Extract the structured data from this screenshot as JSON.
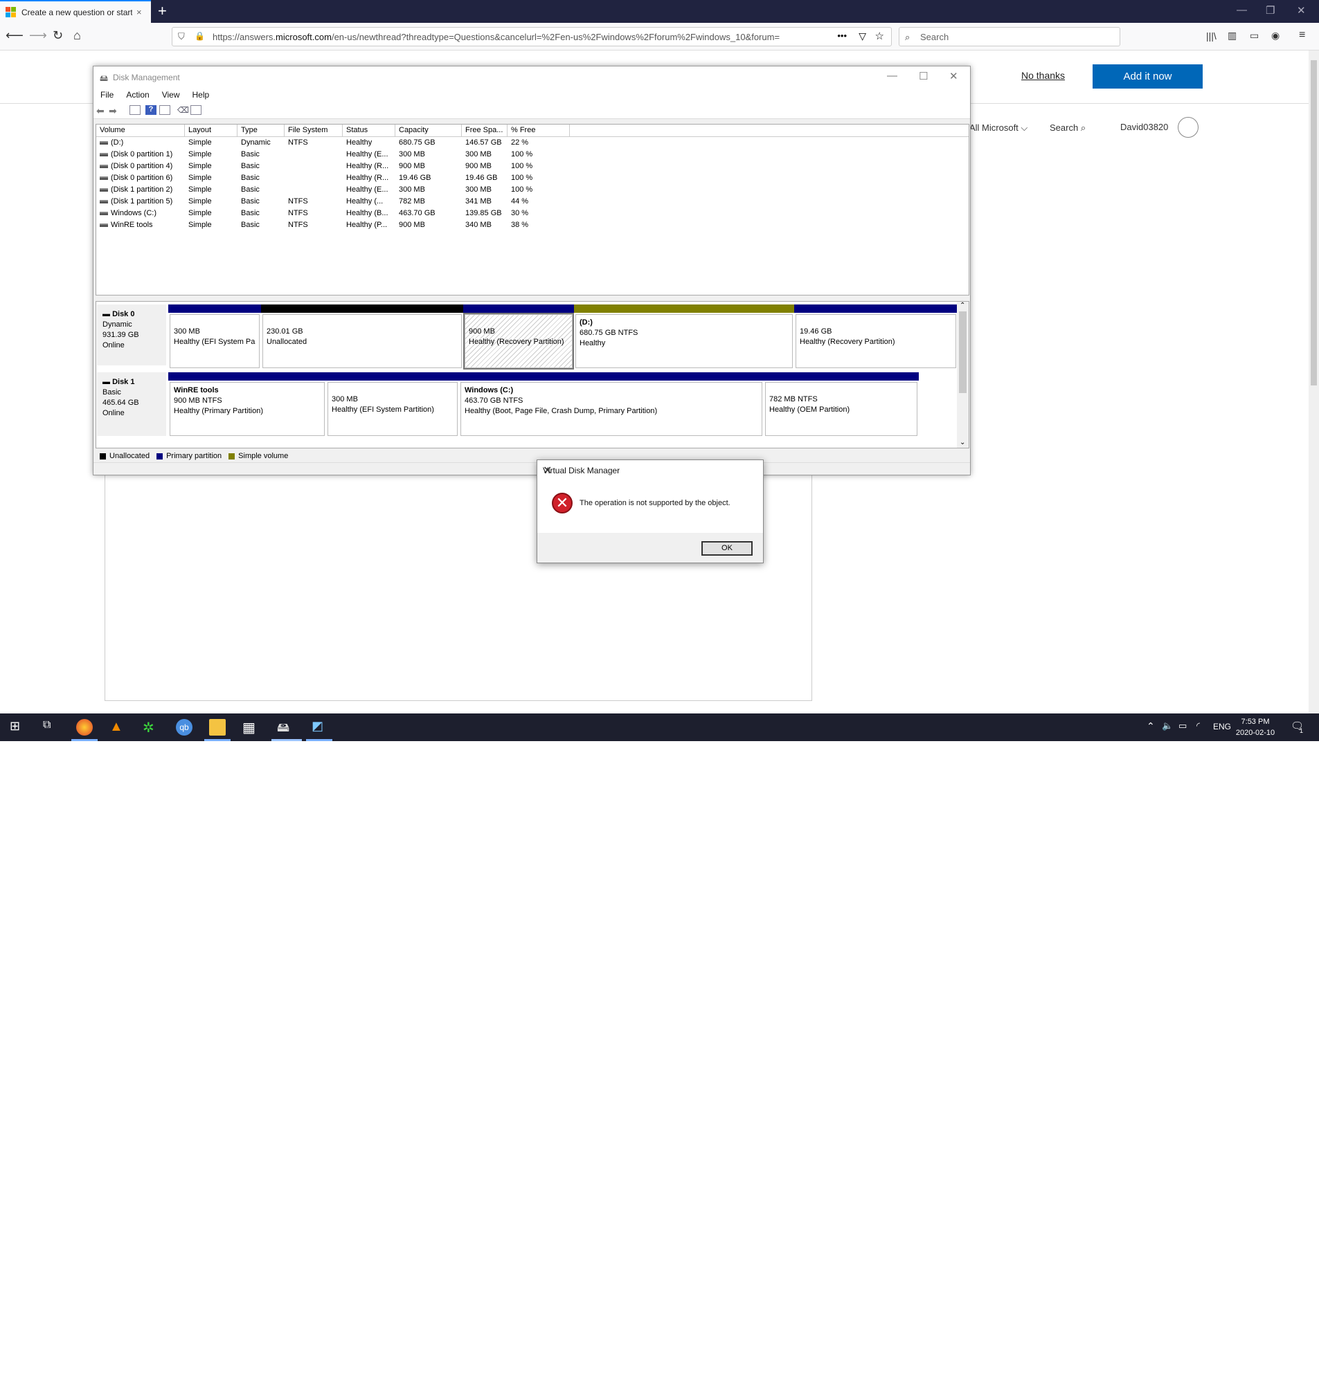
{
  "browser": {
    "tab_title": "Create a new question or start",
    "tab_close": "×",
    "new_tab": "+",
    "url_prefix": "https://answers.",
    "url_domain": "microsoft.com",
    "url_rest": "/en-us/newthread?threadtype=Questions&cancelurl=%2Fen-us%2Fwindows%2Fforum%2Fwindows_10&forum=",
    "search_placeholder": "Search"
  },
  "webpage": {
    "no_thanks": "No thanks",
    "add_it_now": "Add it now",
    "all_microsoft": "All Microsoft ⌵",
    "search": "Search",
    "username": "David03820"
  },
  "disk_mgmt": {
    "title": "Disk Management",
    "menu": [
      "File",
      "Action",
      "View",
      "Help"
    ],
    "columns": [
      "Volume",
      "Layout",
      "Type",
      "File System",
      "Status",
      "Capacity",
      "Free Spa...",
      "% Free"
    ],
    "volumes": [
      [
        "(D:)",
        "Simple",
        "Dynamic",
        "NTFS",
        "Healthy",
        "680.75 GB",
        "146.57 GB",
        "22 %"
      ],
      [
        "(Disk 0 partition 1)",
        "Simple",
        "Basic",
        "",
        "Healthy (E...",
        "300 MB",
        "300 MB",
        "100 %"
      ],
      [
        "(Disk 0 partition 4)",
        "Simple",
        "Basic",
        "",
        "Healthy (R...",
        "900 MB",
        "900 MB",
        "100 %"
      ],
      [
        "(Disk 0 partition 6)",
        "Simple",
        "Basic",
        "",
        "Healthy (R...",
        "19.46 GB",
        "19.46 GB",
        "100 %"
      ],
      [
        "(Disk 1 partition 2)",
        "Simple",
        "Basic",
        "",
        "Healthy (E...",
        "300 MB",
        "300 MB",
        "100 %"
      ],
      [
        "(Disk 1 partition 5)",
        "Simple",
        "Basic",
        "NTFS",
        "Healthy (...",
        "782 MB",
        "341 MB",
        "44 %"
      ],
      [
        "Windows (C:)",
        "Simple",
        "Basic",
        "NTFS",
        "Healthy (B...",
        "463.70 GB",
        "139.85 GB",
        "30 %"
      ],
      [
        "WinRE tools",
        "Simple",
        "Basic",
        "NTFS",
        "Healthy (P...",
        "900 MB",
        "340 MB",
        "38 %"
      ]
    ],
    "disk0": {
      "name": "Disk 0",
      "type": "Dynamic",
      "size": "931.39 GB",
      "state": "Online",
      "partitions": [
        {
          "title": "",
          "line1": "300 MB",
          "line2": "Healthy (EFI System Pa"
        },
        {
          "title": "",
          "line1": "230.01 GB",
          "line2": "Unallocated"
        },
        {
          "title": "",
          "line1": "900 MB",
          "line2": "Healthy (Recovery Partition)"
        },
        {
          "title": "(D:)",
          "line1": "680.75 GB NTFS",
          "line2": "Healthy"
        },
        {
          "title": "",
          "line1": "19.46 GB",
          "line2": "Healthy (Recovery Partition)"
        }
      ]
    },
    "disk1": {
      "name": "Disk 1",
      "type": "Basic",
      "size": "465.64 GB",
      "state": "Online",
      "partitions": [
        {
          "title": "WinRE tools",
          "line1": "900 MB NTFS",
          "line2": "Healthy (Primary Partition)"
        },
        {
          "title": "",
          "line1": "300 MB",
          "line2": "Healthy (EFI System Partition)"
        },
        {
          "title": "Windows  (C:)",
          "line1": "463.70 GB NTFS",
          "line2": "Healthy (Boot, Page File, Crash Dump, Primary Partition)"
        },
        {
          "title": "",
          "line1": "782 MB NTFS",
          "line2": "Healthy (OEM Partition)"
        }
      ]
    },
    "legend": [
      "Unallocated",
      "Primary partition",
      "Simple volume"
    ],
    "colors": {
      "unallocated": "#000000",
      "primary": "#000080",
      "simple": "#808000"
    }
  },
  "dialog": {
    "title": "Virtual Disk Manager",
    "message": "The operation is not supported by the object.",
    "ok": "OK",
    "close": "✕"
  },
  "taskbar": {
    "lang": "ENG",
    "time": "7:53 PM",
    "date": "2020-02-10",
    "notification_count": "1"
  }
}
